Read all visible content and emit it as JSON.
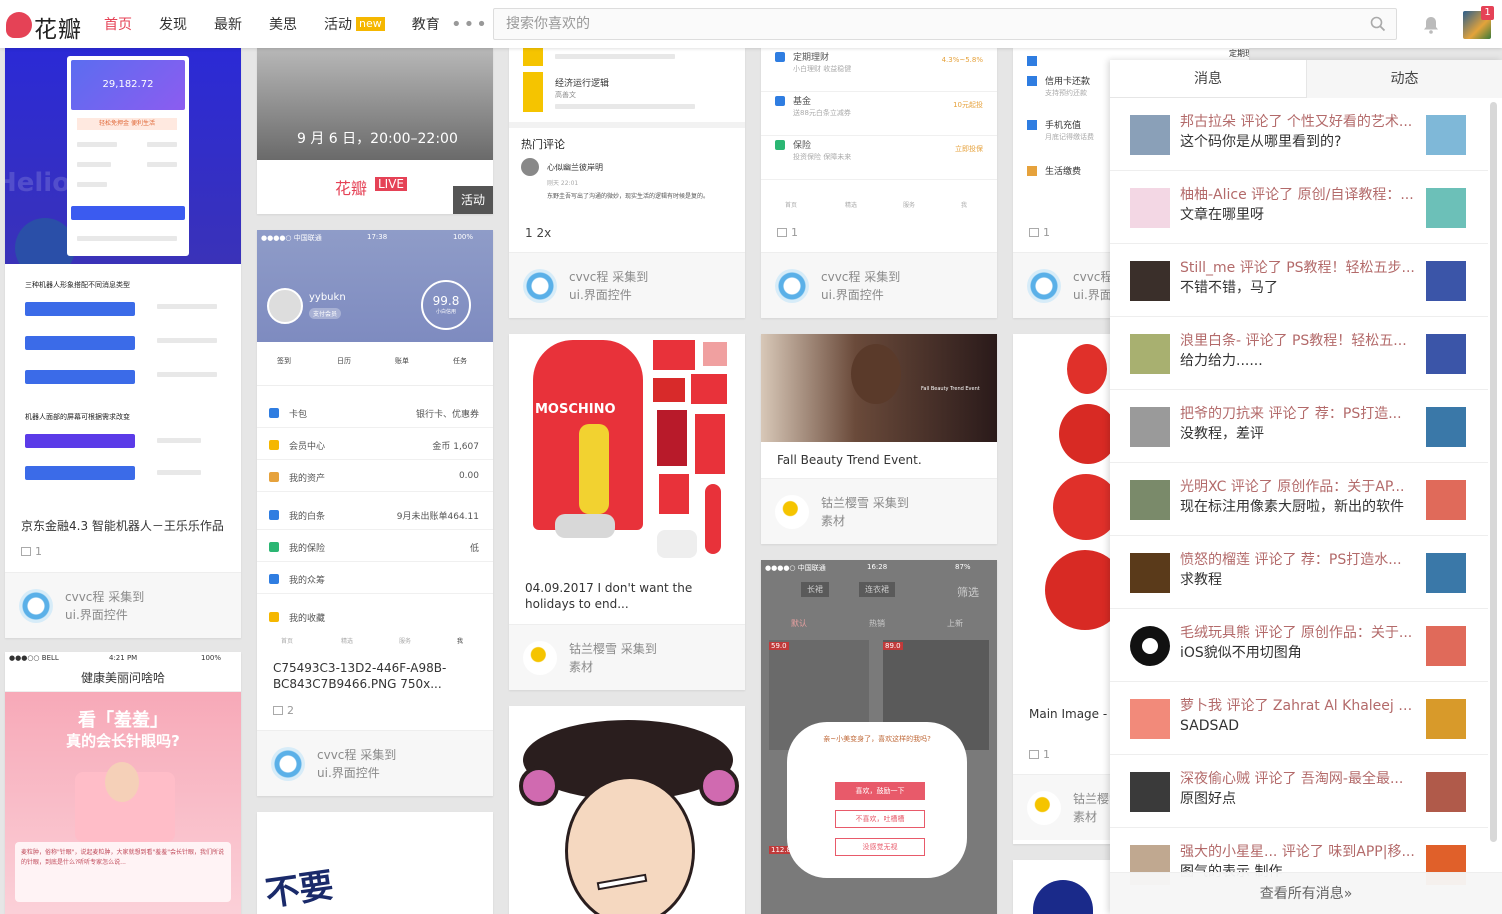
{
  "brand": {
    "name": "花瓣",
    "color": "#e54256"
  },
  "nav": {
    "items": [
      {
        "label": "首页",
        "active": true
      },
      {
        "label": "发现"
      },
      {
        "label": "最新"
      },
      {
        "label": "美思"
      },
      {
        "label": "活动",
        "tag": "new"
      },
      {
        "label": "教育"
      }
    ],
    "more": "•••"
  },
  "search": {
    "placeholder": "搜索你喜欢的"
  },
  "notifications_badge": "1",
  "pins": {
    "p1": {
      "screen_amount": "29,182.72",
      "banner": "轻松免押金 便利生活",
      "section_a": "三种机器人形象搭配不同消息类型",
      "section_b": "机器人面部的屏幕可根据需求改变",
      "desc": "京东金融4.3 智能机器人－王乐乐作品",
      "repins": "1",
      "via_user": "cvvc程 采集到",
      "via_board": "ui.界面控件"
    },
    "p2": {
      "event_time": "9 月 6 日，20:00–22:00",
      "brand_text": "花瓣",
      "live": "LIVE",
      "ribbon": "活动"
    },
    "p3": {
      "carrier": "●●●●○ 中国联通",
      "clock": "17:38",
      "battery": "100%",
      "username": "yybukn",
      "user_tag": "支付会员",
      "score": "99.8",
      "score_label": "小白信用",
      "grid": [
        "签到",
        "日历",
        "账单",
        "任务"
      ],
      "list": [
        {
          "label": "卡包",
          "right": "银行卡、优惠券",
          "color": "#2f7de1"
        },
        {
          "label": "会员中心",
          "right": "金币 1,607",
          "color": "#f5b700"
        },
        {
          "label": "我的资产",
          "right": "0.00",
          "color": "#e6a23c"
        },
        {
          "label": "我的白条",
          "right": "9月未出账单464.11",
          "color": "#2f7de1"
        },
        {
          "label": "我的保险",
          "right": "低",
          "color": "#2bb673"
        },
        {
          "label": "我的众筹",
          "right": "",
          "color": "#2f7de1"
        },
        {
          "label": "我的收藏",
          "right": "",
          "color": "#f5b700"
        }
      ],
      "tabbar": [
        "首页",
        "精选",
        "服务",
        "我"
      ],
      "desc": "C75493C3-13D2-446F-A98B-BC843C7B9466.PNG 750x...",
      "repins": "2",
      "via_user": "cvvc程 采集到",
      "via_board": "ui.界面控件"
    },
    "p4": {
      "items": [
        {
          "title": "经济运行逻辑",
          "sub": "高善文"
        }
      ],
      "hot_title": "热门评论",
      "comment_user": "心似幽兰彼岸明",
      "comment_time": "刚天 22:01",
      "comment_text": "东野圭吾写出了沟通的微妙，现实生活的逻辑有时候是复的。",
      "footer": "1 2x",
      "via_user": "cvvc程 采集到",
      "via_board": "ui.界面控件"
    },
    "p5": {
      "desc": "04.09.2017 I don't want the holidays to end...",
      "shirt_text": "MOSCHINO",
      "via_user": "钴兰樱雪 采集到",
      "via_board": "素材"
    },
    "p6": {
      "items": [
        {
          "title": "定期理财",
          "sub": "小白理财 收益稳健",
          "right": "4.3%~5.8%"
        },
        {
          "title": "基金",
          "sub": "送88元白条立减券",
          "right": "10元起投"
        },
        {
          "title": "保险",
          "sub": "投资保险 保障未来",
          "right": "立即投保"
        }
      ],
      "tabbar": [
        "首页",
        "精选",
        "服务",
        "我"
      ],
      "repins": "1",
      "via_user": "cvvc程 采集到",
      "via_board": "ui.界面控件"
    },
    "p7": {
      "desc": "Fall Beauty Trend Event.",
      "image_caption": "Fall Beauty Trend Event",
      "via_user": "钴兰樱雪 采集到",
      "via_board": "素材"
    },
    "p8": {
      "carrier": "●●●●○ 中国联通",
      "clock": "16:28",
      "battery": "87%",
      "filter": "筛选",
      "chips": [
        "长裙",
        "连衣裙"
      ],
      "sorts": [
        "默认",
        "热销",
        "上新"
      ],
      "bubble": "亲~小美变身了，喜欢这样的我吗?",
      "btn_like": "喜欢，鼓励一下",
      "btn_dislike": "不喜欢，吐槽槽",
      "btn_none": "没感觉无视",
      "prices": [
        "59.0",
        "89.0",
        "112.8"
      ]
    },
    "p9": {
      "status": "●●●○○ BELL",
      "clock": "4:21 PM",
      "battery": "100%",
      "title": "健康美丽问啥哈",
      "headline_1": "看「羞羞」",
      "headline_2": "真的会长针眼吗?",
      "body_text": "麦粒肿，俗称\"针眼\"，说起麦粒肿，大家就想到看\"羞羞\"会长针眼，我们所说的针眼，到底是什么?听听专家怎么说..."
    },
    "p10": {
      "items": [
        {
          "title": "定期理财"
        },
        {
          "title": "信用卡还款",
          "sub": "支持预约还款"
        },
        {
          "title": "手机充值",
          "sub": "月底记得缴话费"
        },
        {
          "title": "生活缴费"
        }
      ],
      "repins": "1",
      "desc": "Main Image - B Shoulder...",
      "via_user": "cvvc程 采集到",
      "via_board": "ui.界面控件",
      "via2_user": "钴兰樱雪 采集到",
      "via2_board": "素材"
    },
    "p11": {
      "text": "不要"
    }
  },
  "panel": {
    "tab_messages": "消息",
    "tab_activity": "动态",
    "items": [
      {
        "user": "邦古拉朵",
        "action": "评论了",
        "target": "个性又好看的艺术...",
        "comment": "这个码你是从哪里看到的?",
        "avatar": "#8aa0b8",
        "thumb": "#7fb8d8"
      },
      {
        "user": "柚柚-Alice",
        "action": "评论了",
        "target": "原创/自译教程：...",
        "comment": "文章在哪里呀",
        "avatar": "#f3d7e4",
        "thumb": "#6cc0b8"
      },
      {
        "user": "Still_me",
        "action": "评论了",
        "target": "PS教程！轻松五步...",
        "comment": "不错不错，马了",
        "avatar": "#3a2f2a",
        "thumb": "#3b55a8"
      },
      {
        "user": "浪里白条-",
        "action": "评论了",
        "target": "PS教程！轻松五...",
        "comment": "给力给力......",
        "avatar": "#a8b070",
        "thumb": "#3b55a8"
      },
      {
        "user": "把爷的刀抗来",
        "action": "评论了",
        "target": "荐：PS打造...",
        "comment": "没教程，差评",
        "avatar": "#9a9a9a",
        "thumb": "#3a78a8"
      },
      {
        "user": "光明XC",
        "action": "评论了",
        "target": "原创作品：关于AP...",
        "comment": "现在标注用像素大厨啦，新出的软件",
        "avatar": "#7a8a6a",
        "thumb": "#e06a5a"
      },
      {
        "user": "愤怒的榴莲",
        "action": "评论了",
        "target": "荐：PS打造水...",
        "comment": "求教程",
        "avatar": "#5a3a1a",
        "thumb": "#3a78a8"
      },
      {
        "user": "毛绒玩具熊",
        "action": "评论了",
        "target": "原创作品：关于...",
        "comment": "iOS貌似不用切图角",
        "avatar": "#ffffff",
        "thumb": "#e06a5a"
      },
      {
        "user": "萝卜我",
        "action": "评论了",
        "target": "Zahrat Al Khaleej Br...",
        "comment": "SADSAD",
        "avatar": "#f28a7a",
        "thumb": "#d89a2a"
      },
      {
        "user": "深夜偷心贼",
        "action": "评论了",
        "target": "吾淘网-最全最...",
        "comment": "原图好点",
        "avatar": "#3a3a3a",
        "thumb": "#b05a4a"
      },
      {
        "user": "强大的小星星...",
        "action": "评论了",
        "target": "味到APP|移...",
        "comment": "图气的表示 制作",
        "avatar": "#c0a890",
        "thumb": "#e0602a"
      }
    ],
    "see_all": "查看所有消息»"
  }
}
